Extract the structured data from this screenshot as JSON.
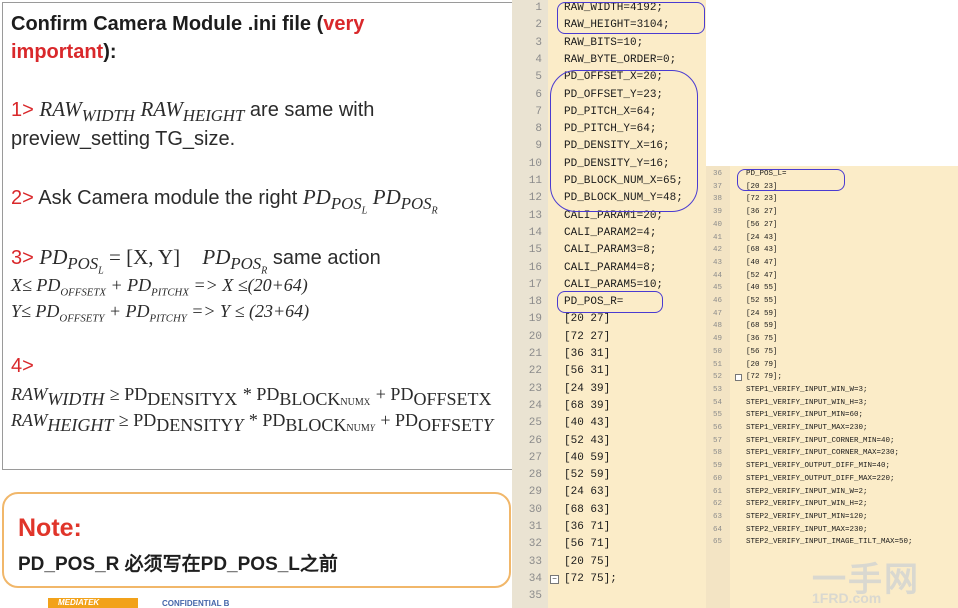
{
  "slide": {
    "title_a": "Confirm Camera Module .ini  file (",
    "title_red": "very",
    "title_red2": "important",
    "title_b": "):",
    "s1_num": "1>",
    "s1_math_a": "RAW",
    "s1_sub_a": "WIDTH",
    "s1_math_b": "RAW",
    "s1_sub_b": "HEIGHT",
    "s1_text": "are same with",
    "s1_line2": "preview_setting  TG_size.",
    "s2_num": "2>",
    "s2_text": "Ask Camera module the right",
    "s2_pd": "PD",
    "s2_pos": "POS",
    "s2_l": "L",
    "s2_r": "R",
    "s3_num": "3>",
    "s3_eq": "=  [X, Y]",
    "s3_text": "same action",
    "s3_line2_a": "X≤ PD",
    "s3_line2_offx": "OFFSET",
    "s3_line2_x": "X",
    "s3_line2_b": "+ PD",
    "s3_line2_pitch": "PITCH",
    "s3_line2_c": "=> X ≤(20+64)",
    "s3_line3_a": "Y≤ PD",
    "s3_line3_offy": "OFFSET",
    "s3_line3_y": "Y",
    "s3_line3_b": "+ PD",
    "s3_line3_pitch": "PITCH",
    "s3_line3_c": "=> Y ≤ (23+64)",
    "s4_num": "4>",
    "s4_line1_a": "RAW",
    "s4_line1_sub": "WIDTH",
    "s4_line1_b": "≥ PD",
    "s4_density": "DENSITY",
    "s4_line1_x": "X",
    "s4_line1_c": "* PD",
    "s4_block": "BLOCK",
    "s4_num_sub": "NUM",
    "s4_line1_d": "+ PD",
    "s4_offset": "OFFSET",
    "s4_line2_a": "RAW",
    "s4_line2_sub": "HEIGHT",
    "s4_line2_y": "Y"
  },
  "note": {
    "title": "Note:",
    "text": "PD_POS_R  必须写在PD_POS_L之前"
  },
  "footer": {
    "logo": "MEDIATEK",
    "confidential": "CONFIDENTIAL B"
  },
  "editor1": {
    "lines": [
      {
        "n": "1",
        "t": "RAW_WIDTH=4192;"
      },
      {
        "n": "2",
        "t": "RAW_HEIGHT=3104;"
      },
      {
        "n": "3",
        "t": "RAW_BITS=10;"
      },
      {
        "n": "4",
        "t": "RAW_BYTE_ORDER=0;"
      },
      {
        "n": "5",
        "t": "PD_OFFSET_X=20;"
      },
      {
        "n": "6",
        "t": "PD_OFFSET_Y=23;"
      },
      {
        "n": "7",
        "t": "PD_PITCH_X=64;"
      },
      {
        "n": "8",
        "t": "PD_PITCH_Y=64;"
      },
      {
        "n": "9",
        "t": "PD_DENSITY_X=16;"
      },
      {
        "n": "10",
        "t": "PD_DENSITY_Y=16;"
      },
      {
        "n": "11",
        "t": "PD_BLOCK_NUM_X=65;"
      },
      {
        "n": "12",
        "t": "PD_BLOCK_NUM_Y=48;"
      },
      {
        "n": "13",
        "t": "CALI_PARAM1=20;"
      },
      {
        "n": "14",
        "t": "CALI_PARAM2=4;"
      },
      {
        "n": "15",
        "t": "CALI_PARAM3=8;"
      },
      {
        "n": "16",
        "t": "CALI_PARAM4=8;"
      },
      {
        "n": "17",
        "t": "CALI_PARAM5=10;"
      },
      {
        "n": "18",
        "t": "PD_POS_R="
      },
      {
        "n": "19",
        "t": "[20 27]"
      },
      {
        "n": "20",
        "t": "[72 27]"
      },
      {
        "n": "21",
        "t": "[36 31]"
      },
      {
        "n": "22",
        "t": "[56 31]"
      },
      {
        "n": "23",
        "t": "[24 39]"
      },
      {
        "n": "24",
        "t": "[68 39]"
      },
      {
        "n": "25",
        "t": "[40 43]"
      },
      {
        "n": "26",
        "t": "[52 43]"
      },
      {
        "n": "27",
        "t": "[40 59]"
      },
      {
        "n": "28",
        "t": "[52 59]"
      },
      {
        "n": "29",
        "t": "[24 63]"
      },
      {
        "n": "30",
        "t": "[68 63]"
      },
      {
        "n": "31",
        "t": "[36 71]"
      },
      {
        "n": "32",
        "t": "[56 71]"
      },
      {
        "n": "33",
        "t": "[20 75]"
      },
      {
        "n": "34",
        "t": "[72 75];"
      },
      {
        "n": "35",
        "t": ""
      }
    ]
  },
  "editor2": {
    "lines": [
      {
        "n": "36",
        "t": "PD_POS_L="
      },
      {
        "n": "37",
        "t": "[20 23]"
      },
      {
        "n": "38",
        "t": "[72 23]"
      },
      {
        "n": "39",
        "t": "[36 27]"
      },
      {
        "n": "40",
        "t": "[56 27]"
      },
      {
        "n": "41",
        "t": "[24 43]"
      },
      {
        "n": "42",
        "t": "[68 43]"
      },
      {
        "n": "43",
        "t": "[40 47]"
      },
      {
        "n": "44",
        "t": "[52 47]"
      },
      {
        "n": "45",
        "t": "[40 55]"
      },
      {
        "n": "46",
        "t": "[52 55]"
      },
      {
        "n": "47",
        "t": "[24 59]"
      },
      {
        "n": "48",
        "t": "[68 59]"
      },
      {
        "n": "49",
        "t": "[36 75]"
      },
      {
        "n": "50",
        "t": "[56 75]"
      },
      {
        "n": "51",
        "t": "[20 79]"
      },
      {
        "n": "52",
        "t": "[72 79];"
      },
      {
        "n": "53",
        "t": "STEP1_VERIFY_INPUT_WIN_W=3;"
      },
      {
        "n": "54",
        "t": "STEP1_VERIFY_INPUT_WIN_H=3;"
      },
      {
        "n": "55",
        "t": "STEP1_VERIFY_INPUT_MIN=60;"
      },
      {
        "n": "56",
        "t": "STEP1_VERIFY_INPUT_MAX=230;"
      },
      {
        "n": "57",
        "t": "STEP1_VERIFY_INPUT_CORNER_MIN=40;"
      },
      {
        "n": "58",
        "t": "STEP1_VERIFY_INPUT_CORNER_MAX=230;"
      },
      {
        "n": "59",
        "t": "STEP1_VERIFY_OUTPUT_DIFF_MIN=40;"
      },
      {
        "n": "60",
        "t": "STEP1_VERIFY_OUTPUT_DIFF_MAX=220;"
      },
      {
        "n": "61",
        "t": "STEP2_VERIFY_INPUT_WIN_W=2;"
      },
      {
        "n": "62",
        "t": "STEP2_VERIFY_INPUT_WIN_H=2;"
      },
      {
        "n": "63",
        "t": "STEP2_VERIFY_INPUT_MIN=120;"
      },
      {
        "n": "64",
        "t": "STEP2_VERIFY_INPUT_MAX=230;"
      },
      {
        "n": "65",
        "t": "STEP2_VERIFY_INPUT_IMAGE_TILT_MAX=50;"
      }
    ]
  },
  "watermark": {
    "text": "一手网",
    "sub": "1FRD.com"
  }
}
